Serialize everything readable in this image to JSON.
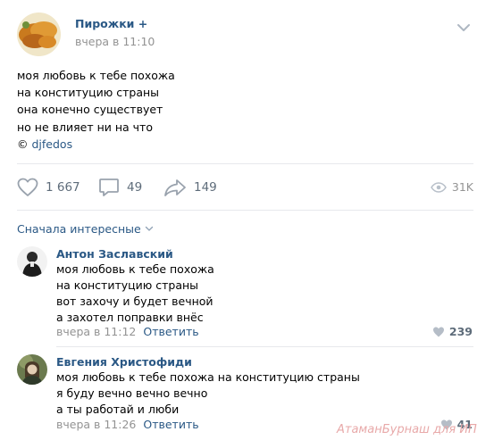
{
  "post": {
    "author": "Пирожки +",
    "time": "вчера в 11:10",
    "text_lines": [
      "моя любовь к тебе похожа",
      "на конституцию страны",
      "она конечно существует",
      "но не влияет ни на что"
    ],
    "attribution_prefix": "© ",
    "attribution_link": "djfedos"
  },
  "actions": {
    "likes": "1 667",
    "comments": "49",
    "shares": "149",
    "views": "31K"
  },
  "comments_sort": "Сначала интересные",
  "comments": [
    {
      "author": "Антон Заславский",
      "lines": [
        "моя любовь к тебе похожа",
        "на конституцию страны",
        "вот захочу и будет вечной",
        "а захотел поправки внёс"
      ],
      "time": "вчера в 11:12",
      "reply": "Ответить",
      "likes": "239"
    },
    {
      "author": "Евгения Христофиди",
      "lines": [
        "моя любовь к тебе похожа на конституцию страны",
        "я буду вечно вечно вечно",
        "а ты работай и люби"
      ],
      "time": "вчера в 11:26",
      "reply": "Ответить",
      "likes": "41"
    }
  ],
  "watermark": "АтаманБурнаш для ИП",
  "colors": {
    "link": "#2a5885",
    "muted": "#939393",
    "icon": "#828a99",
    "divider": "#e7e8ec"
  }
}
